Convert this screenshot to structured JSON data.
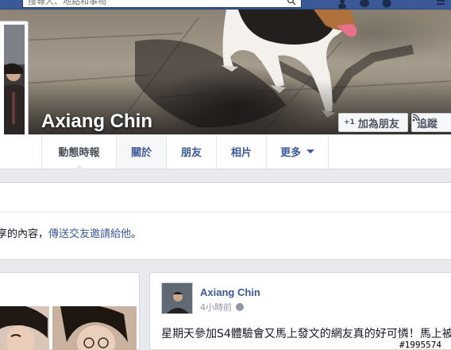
{
  "topbar": {
    "search_placeholder": "搜尋人、地點和事物",
    "bg_color": "#3b5998"
  },
  "cover": {
    "profile_name": "Axiang Chin",
    "add_friend_icon": "+1",
    "add_friend_label": "加為朋友",
    "follow_icon": "rss-icon",
    "follow_label": "追蹤"
  },
  "tabs": [
    {
      "label": "動態時報",
      "active": true
    },
    {
      "label": "關於",
      "active": false
    },
    {
      "label": "朋友",
      "active": false
    },
    {
      "label": "相片",
      "active": false
    },
    {
      "label": "更多",
      "active": false
    }
  ],
  "notice": {
    "text_prefix": "享的內容，",
    "link_text": "傳送交友邀請給他",
    "text_suffix": "。"
  },
  "post": {
    "author": "Axiang Chin",
    "time": "4小時前",
    "privacy_icon": "globe-icon",
    "text": "星期天參加S4體驗會又馬上發文的網友真的好可憐！馬上被"
  },
  "watermark": "#1995574",
  "colors": {
    "link": "#3b5998",
    "background": "#e9eaed",
    "muted": "#9197a3"
  }
}
